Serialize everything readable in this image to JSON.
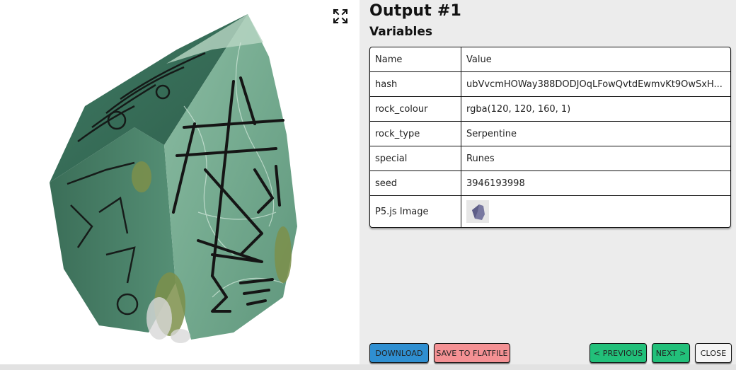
{
  "header": {
    "output_title": "Output #1",
    "variables_title": "Variables"
  },
  "image": {
    "description_icon": "expand-icon",
    "colors": {
      "rock_main": "#6aa38a",
      "rock_dark": "#3f7a63",
      "rock_light": "#a9cdb8",
      "rune": "#151515",
      "moss": "#7c8f4a"
    }
  },
  "table": {
    "headers": {
      "name": "Name",
      "value": "Value"
    },
    "rows": [
      {
        "name": "hash",
        "value": "ubVvcmHOWay388DODJOqLFowQvtdEwmvKt9OwSxH..."
      },
      {
        "name": "rock_colour",
        "value": "rgba(120, 120, 160, 1)"
      },
      {
        "name": "rock_type",
        "value": "Serpentine"
      },
      {
        "name": "special",
        "value": "Runes"
      },
      {
        "name": "seed",
        "value": "3946193998"
      }
    ],
    "image_row": {
      "name": "P5.js Image",
      "thumb_color": "#7878a0"
    }
  },
  "buttons": {
    "download": "DOWNLOAD",
    "save": "SAVE TO FLATFILE",
    "previous": "< PREVIOUS",
    "next": "NEXT >",
    "close": "CLOSE"
  }
}
